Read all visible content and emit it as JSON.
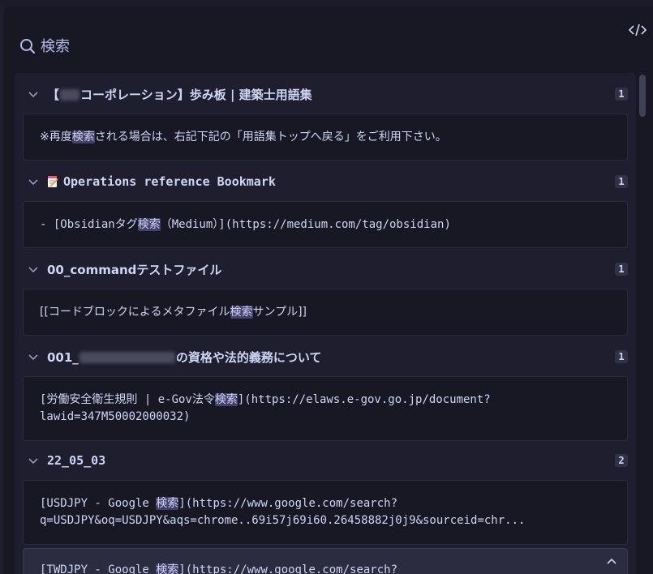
{
  "header": {
    "search_placeholder": "検索"
  },
  "icons": {
    "search": "search-icon",
    "code": "code-icon",
    "chevron": "chevron-down-icon",
    "collapse": "chevron-up-icon",
    "memo": "memo-icon"
  },
  "colors": {
    "accent": "#b4b9e6",
    "highlight": "#45406b",
    "panel": "#181825",
    "results_bg": "#1e1e2e"
  },
  "results": [
    {
      "title_pre": "【",
      "title_post": "コーポレーション】歩み板 | 建築士用語集",
      "count": "1",
      "matches": [
        {
          "pre": "※再度",
          "hit": "検索",
          "post": "される場合は、右記下記の「用語集トップへ戻る」をご利用下さい。"
        }
      ]
    },
    {
      "title": "Operations reference Bookmark",
      "count": "1",
      "matches": [
        {
          "pre": "- [Obsidianタグ",
          "hit": "検索",
          "post": "（Medium）](https://medium.com/tag/obsidian)"
        }
      ]
    },
    {
      "title": "00_commandテストファイル",
      "count": "1",
      "matches": [
        {
          "pre": "[[コードブロックによるメタファイル",
          "hit": "検索",
          "post": "サンプル]]"
        }
      ]
    },
    {
      "title_pre": "001_",
      "title_post": "の資格や法的義務について",
      "count": "1",
      "matches": [
        {
          "pre": "[労働安全衛生規則 | e-Gov法令",
          "hit": "検索",
          "post": "](https://elaws.e-gov.go.jp/document?",
          "line2": "lawid=347M50002000032)"
        }
      ]
    },
    {
      "title": "22_05_03",
      "count": "2",
      "matches": [
        {
          "pre": "[USDJPY - Google ",
          "hit": "検索",
          "post": "](https://www.google.com/search?",
          "line2": "q=USDJPY&oq=USDJPY&aqs=chrome..69i57j69i60.26458882j0j9&sourceid=chr..."
        },
        {
          "pre": "[TWDJPY - Google ",
          "hit": "検索",
          "post": "](https://www.google.com/search?"
        }
      ]
    }
  ]
}
